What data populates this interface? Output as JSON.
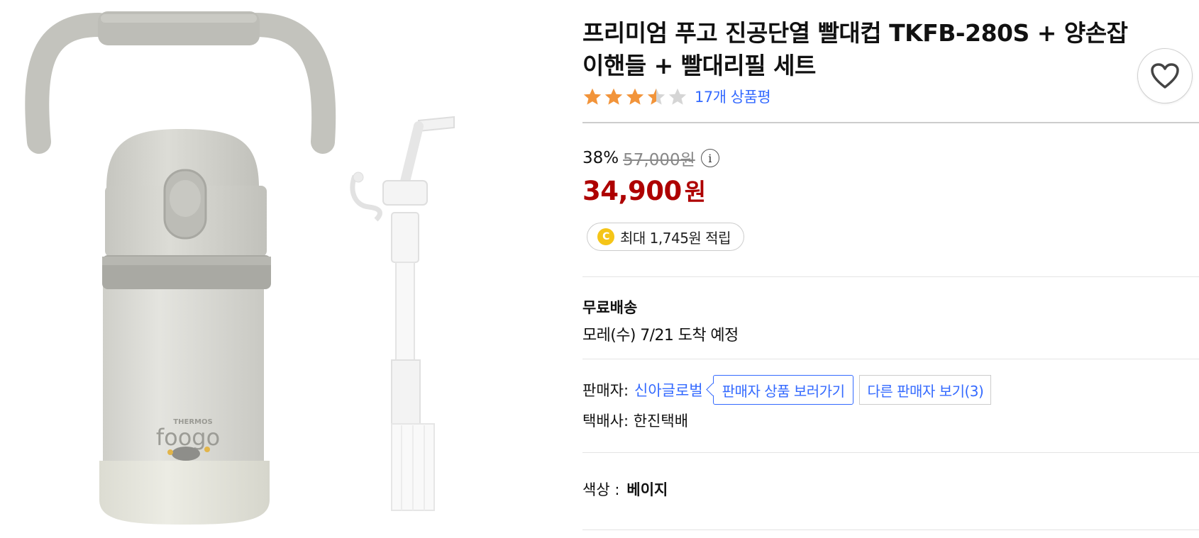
{
  "product": {
    "title": "프리미엄 푸고 진공단열 빨대컵 TKFB-280S + 양손잡이핸들 + 빨대리필 세트",
    "rating": 3.5,
    "rating_max": 5,
    "review_count_label": "17개 상품평",
    "image_brand_text_top": "THERMOS",
    "image_brand_text_main": "foogo"
  },
  "price": {
    "discount_rate": "38%",
    "original_price": "57,000원",
    "info_icon": "i",
    "sale_amount": "34,900",
    "sale_currency": "원",
    "cash_coin": "C",
    "cash_reward": "최대 1,745원 적립"
  },
  "shipping": {
    "label": "무료배송",
    "eta": "모레(수) 7/21 도착 예정"
  },
  "seller": {
    "label": "판매자:",
    "name": "신아글로벌",
    "products_button": "판매자 상품 보러가기",
    "other_sellers_button": "다른 판매자 보기(3)",
    "courier_label": "택배사:",
    "courier_name": "한진택배"
  },
  "option": {
    "label": "색상 :",
    "value": "베이지"
  },
  "colors": {
    "link_blue": "#346aff",
    "sale_red": "#ae0000",
    "star_orange": "#f2943a",
    "star_gray": "#d5d5d5"
  }
}
